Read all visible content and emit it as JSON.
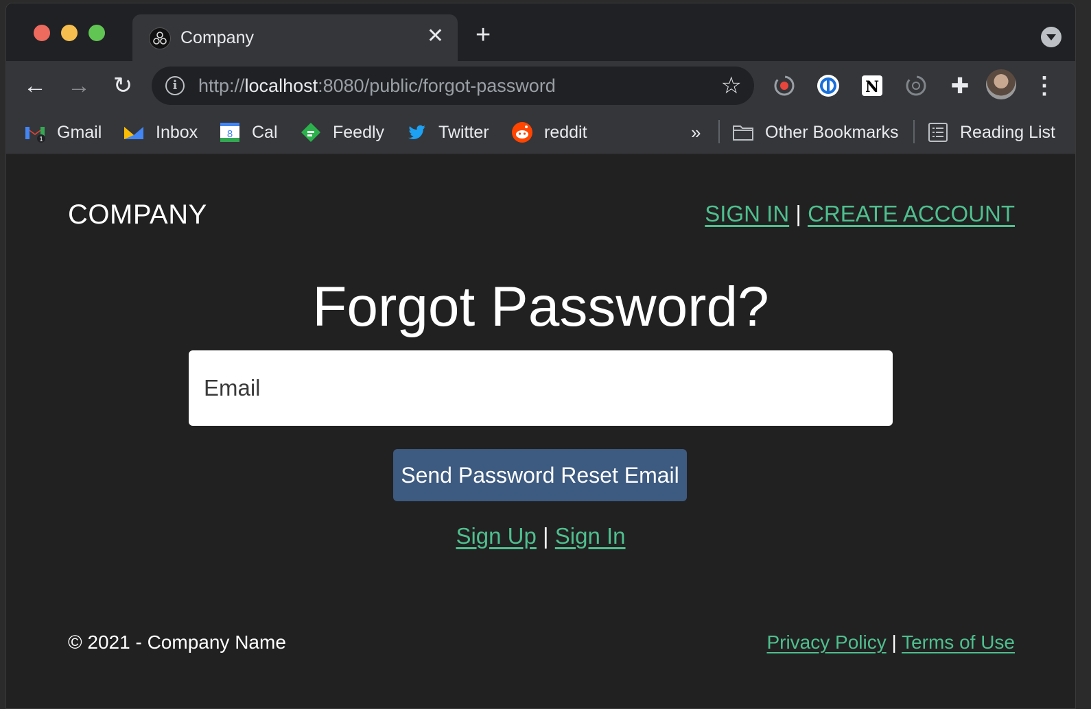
{
  "browser": {
    "tab": {
      "title": "Company",
      "close_glyph": "✕"
    },
    "new_tab_glyph": "+",
    "nav": {
      "back_glyph": "←",
      "forward_glyph": "→",
      "reload_glyph": "↻"
    },
    "url": {
      "scheme": "http://",
      "host": "localhost",
      "rest": ":8080/public/forgot-password"
    },
    "star_glyph": "☆",
    "menu_glyph": "⋮",
    "bookmarks": [
      {
        "label": "Gmail",
        "icon": "gmail-icon"
      },
      {
        "label": "Inbox",
        "icon": "inbox-icon"
      },
      {
        "label": "Cal",
        "icon": "calendar-icon",
        "badge": "8"
      },
      {
        "label": "Feedly",
        "icon": "feedly-icon"
      },
      {
        "label": "Twitter",
        "icon": "twitter-icon"
      },
      {
        "label": "reddit",
        "icon": "reddit-icon"
      }
    ],
    "bookmarks_more": "»",
    "other_bookmarks": "Other Bookmarks",
    "reading_list": "Reading List",
    "extension_glyph": "✚"
  },
  "page": {
    "logo": "COMPANY",
    "header": {
      "sign_in": "SIGN IN",
      "separator": "|",
      "create_account": "CREATE ACCOUNT"
    },
    "heading": "Forgot Password?",
    "email_placeholder": "Email",
    "submit_label": "Send Password Reset Email",
    "auth_links": {
      "sign_up": "Sign Up",
      "separator": "|",
      "sign_in": "Sign In"
    },
    "footer": {
      "copyright": "© 2021 - Company Name",
      "privacy": "Privacy Policy",
      "separator": "|",
      "terms": "Terms of Use"
    }
  },
  "colors": {
    "link": "#4fbf8f",
    "button": "#3d5a80",
    "page_bg": "#212121"
  }
}
